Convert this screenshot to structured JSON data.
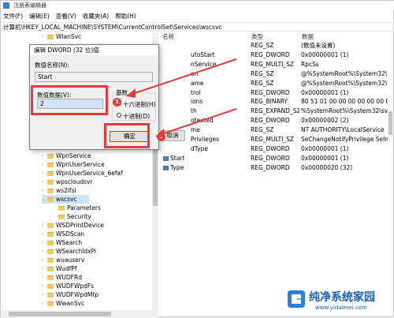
{
  "window": {
    "title": "注册表编辑器"
  },
  "menu": [
    "文件(F)",
    "编辑(E)",
    "查看(V)",
    "收藏夹(A)",
    "帮助(H)"
  ],
  "address": "计算机\\HKEY_LOCAL_MACHINE\\SYSTEM\\CurrentControlSet\\Services\\wscsvc",
  "tree": {
    "top": [
      "WlanSvc"
    ],
    "items": [
      "WpnService",
      "WpnUserService",
      "WpnUserService_6efaf",
      "wpscloudsvr",
      "ws2ifsl",
      "wscsvc",
      "Parameters",
      "Security",
      "WSDPrintDevice",
      "WSDScan",
      "WSearch",
      "WSearchIdxPi",
      "wuauserv",
      "WudfPf",
      "WUDFRd",
      "WUDFWpdFs",
      "WUDFWpdMtp",
      "WwanSvc"
    ]
  },
  "list": {
    "headers": {
      "name": "名称",
      "type": "类型",
      "data": "数据"
    },
    "rows": [
      {
        "name": "",
        "type": "REG_SZ",
        "data": "(数值未设置)"
      },
      {
        "name": "utoStart",
        "type": "REG_DWORD",
        "data": "0x00000001 (1)"
      },
      {
        "name": "nService",
        "type": "REG_MULTI_SZ",
        "data": "RpcSs"
      },
      {
        "name": "on",
        "type": "REG_SZ",
        "data": "@%SystemRoot%\\System32\\wscsvc.c"
      },
      {
        "name": "ame",
        "type": "REG_SZ",
        "data": "@%SystemRoot%\\System32\\wscsvc.c"
      },
      {
        "name": "trol",
        "type": "REG_DWORD",
        "data": "0x00000001 (1)"
      },
      {
        "name": "ions",
        "type": "REG_BINARY",
        "data": "80 51 01 00 00 00 00 00 00 00 00 0"
      },
      {
        "name": "th",
        "type": "REG_EXPAND_SZ",
        "data": "%SystemRoot%\\System32\\svchost.e"
      },
      {
        "name": "otected",
        "type": "REG_DWORD",
        "data": "0x00000002 (2)"
      },
      {
        "name": "me",
        "type": "REG_SZ",
        "data": "NT AUTHORITY\\LocalService"
      },
      {
        "name": "Privileges",
        "type": "REG_MULTI_SZ",
        "data": "SeChangeNotifyPrivilege SeImpers"
      },
      {
        "name": "dType",
        "type": "REG_DWORD",
        "data": "0x00000001 (1)"
      },
      {
        "name": "Start",
        "type": "REG_DWORD",
        "data": "0x00000001 (1)"
      },
      {
        "name": "Type",
        "type": "REG_DWORD",
        "data": "0x00000020 (32)"
      }
    ]
  },
  "dialog": {
    "title": "编辑 DWORD (32 位)值",
    "name_label": "数值名称(N):",
    "name_value": "Start",
    "data_label": "数值数据(V):",
    "data_value": "2",
    "base_label": "基数",
    "hex_label": "十六进制(H)",
    "dec_label": "十进制(D)",
    "ok": "确定",
    "cancel": "取消"
  },
  "annotations": {
    "step1": "1",
    "step2": "2"
  },
  "watermark": {
    "title": "纯净系统家园",
    "url": "www.yidaimei.com"
  },
  "colors": {
    "accent": "#0078d7",
    "annotation": "#e53a3a",
    "selection": "#cce4f7"
  }
}
